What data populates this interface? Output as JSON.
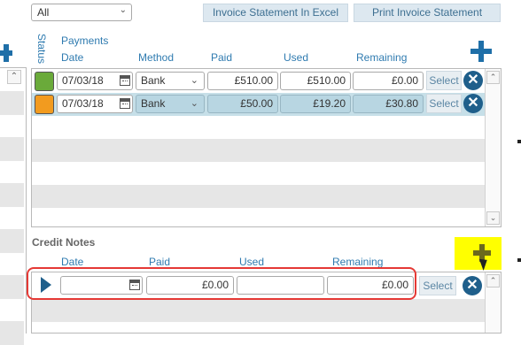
{
  "filter": {
    "selected": "All"
  },
  "toolbar": {
    "invoice_excel_label": "Invoice Statement In Excel",
    "print_invoice_label": "Print Invoice Statement"
  },
  "payments": {
    "status_label": "Status",
    "section_label": "Payments",
    "columns": {
      "date": "Date",
      "method": "Method",
      "paid": "Paid",
      "used": "Used",
      "remaining": "Remaining"
    },
    "rows": [
      {
        "status_color": "#6aaa3a",
        "date": "07/03/18",
        "method": "Bank",
        "paid": "£510.00",
        "used": "£510.00",
        "remaining": "£0.00",
        "select": "Select"
      },
      {
        "status_color": "#f29b1f",
        "date": "07/03/18",
        "method": "Bank",
        "paid": "£50.00",
        "used": "£19.20",
        "remaining": "£30.80",
        "select": "Select"
      }
    ]
  },
  "credit_notes": {
    "title": "Credit Notes",
    "columns": {
      "date": "Date",
      "paid": "Paid",
      "used": "Used",
      "remaining": "Remaining"
    },
    "row": {
      "date": "",
      "paid": "£0.00",
      "used": "",
      "remaining": "£0.00",
      "select": "Select"
    }
  },
  "icons": {
    "add": "plus-icon",
    "remove": "close-icon",
    "calendar": "calendar-icon",
    "expand": "play-icon",
    "dropdown": "chevron-down-icon",
    "scroll_up": "chevron-up-icon",
    "scroll_down": "chevron-down-icon"
  },
  "glyphs": {
    "chevron_down": "⌄",
    "chevron_up": "⌃",
    "close": "✕"
  },
  "colors": {
    "accent": "#1f5f8b",
    "header_text": "#2f7bb0",
    "row_highlight": "#c6dfe8",
    "highlight_yellow": "#ffff00",
    "callout_red": "#e53935"
  }
}
